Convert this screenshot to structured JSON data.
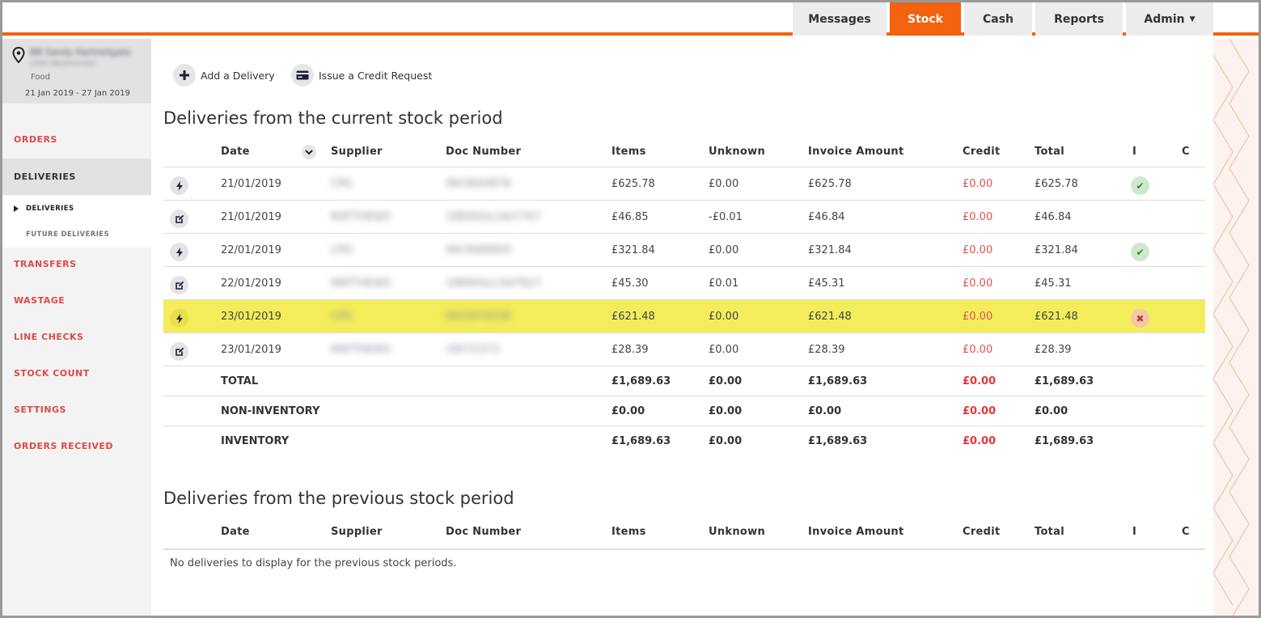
{
  "nav": {
    "tabs": [
      {
        "label": "Messages"
      },
      {
        "label": "Stock"
      },
      {
        "label": "Cash"
      },
      {
        "label": "Reports"
      },
      {
        "label": "Admin"
      }
    ]
  },
  "sidebar": {
    "site_name": "BB Sandy Hartnellgate",
    "site_sub": "Little Westminster",
    "site_type": "Food",
    "period": "21 Jan 2019 - 27 Jan 2019",
    "items": [
      {
        "label": "ORDERS"
      },
      {
        "label": "DELIVERIES"
      },
      {
        "label": "TRANSFERS"
      },
      {
        "label": "WASTAGE"
      },
      {
        "label": "LINE CHECKS"
      },
      {
        "label": "STOCK COUNT"
      },
      {
        "label": "SETTINGS"
      },
      {
        "label": "ORDERS RECEIVED"
      }
    ],
    "sub_items": [
      {
        "label": "DELIVERIES"
      },
      {
        "label": "FUTURE DELIVERIES"
      }
    ]
  },
  "actions": {
    "add_delivery": "Add a Delivery",
    "credit_request": "Issue a Credit Request"
  },
  "current": {
    "title": "Deliveries from the current stock period",
    "headers": [
      "Date",
      "Supplier",
      "Doc Number",
      "Items",
      "Unknown",
      "Invoice Amount",
      "Credit",
      "Total",
      "I",
      "C"
    ],
    "rows": [
      {
        "icon": "lightning",
        "date": "21/01/2019",
        "supplier": "CPG",
        "doc": "INV3664878",
        "items": "£625.78",
        "unknown": "£0.00",
        "invoice": "£625.78",
        "credit": "£0.00",
        "total": "£625.78",
        "status": "ok"
      },
      {
        "icon": "edit",
        "date": "21/01/2019",
        "supplier": "MATTHEWS",
        "doc": "18890GLCA07767",
        "items": "£46.85",
        "unknown": "-£0.01",
        "invoice": "£46.84",
        "credit": "£0.00",
        "total": "£46.84",
        "status": ""
      },
      {
        "icon": "lightning",
        "date": "22/01/2019",
        "supplier": "CPG",
        "doc": "INV3688809",
        "items": "£321.84",
        "unknown": "£0.00",
        "invoice": "£321.84",
        "credit": "£0.00",
        "total": "£321.84",
        "status": "ok"
      },
      {
        "icon": "edit",
        "date": "22/01/2019",
        "supplier": "MATTHEWS",
        "doc": "18890GLCA07827",
        "items": "£45.30",
        "unknown": "£0.01",
        "invoice": "£45.31",
        "credit": "£0.00",
        "total": "£45.31",
        "status": ""
      },
      {
        "icon": "lightning",
        "date": "23/01/2019",
        "supplier": "CPG",
        "doc": "INV3970538",
        "items": "£621.48",
        "unknown": "£0.00",
        "invoice": "£621.48",
        "credit": "£0.00",
        "total": "£621.48",
        "status": "bad"
      },
      {
        "icon": "edit",
        "date": "23/01/2019",
        "supplier": "MATTHEWS",
        "doc": "18572373",
        "items": "£28.39",
        "unknown": "£0.00",
        "invoice": "£28.39",
        "credit": "£0.00",
        "total": "£28.39",
        "status": ""
      }
    ],
    "summary": [
      {
        "label": "TOTAL",
        "items": "£1,689.63",
        "unknown": "£0.00",
        "invoice": "£1,689.63",
        "credit": "£0.00",
        "total": "£1,689.63"
      },
      {
        "label": "NON-INVENTORY",
        "items": "£0.00",
        "unknown": "£0.00",
        "invoice": "£0.00",
        "credit": "£0.00",
        "total": "£0.00"
      },
      {
        "label": "INVENTORY",
        "items": "£1,689.63",
        "unknown": "£0.00",
        "invoice": "£1,689.63",
        "credit": "£0.00",
        "total": "£1,689.63"
      }
    ]
  },
  "previous": {
    "title": "Deliveries from the previous stock period",
    "headers": [
      "Date",
      "Supplier",
      "Doc Number",
      "Items",
      "Unknown",
      "Invoice Amount",
      "Credit",
      "Total",
      "I",
      "C"
    ],
    "empty": "No deliveries to display for the previous stock periods."
  },
  "colors": {
    "accent": "#f2620f",
    "highlight": "#f3ed5b",
    "credit": "#e05050"
  }
}
